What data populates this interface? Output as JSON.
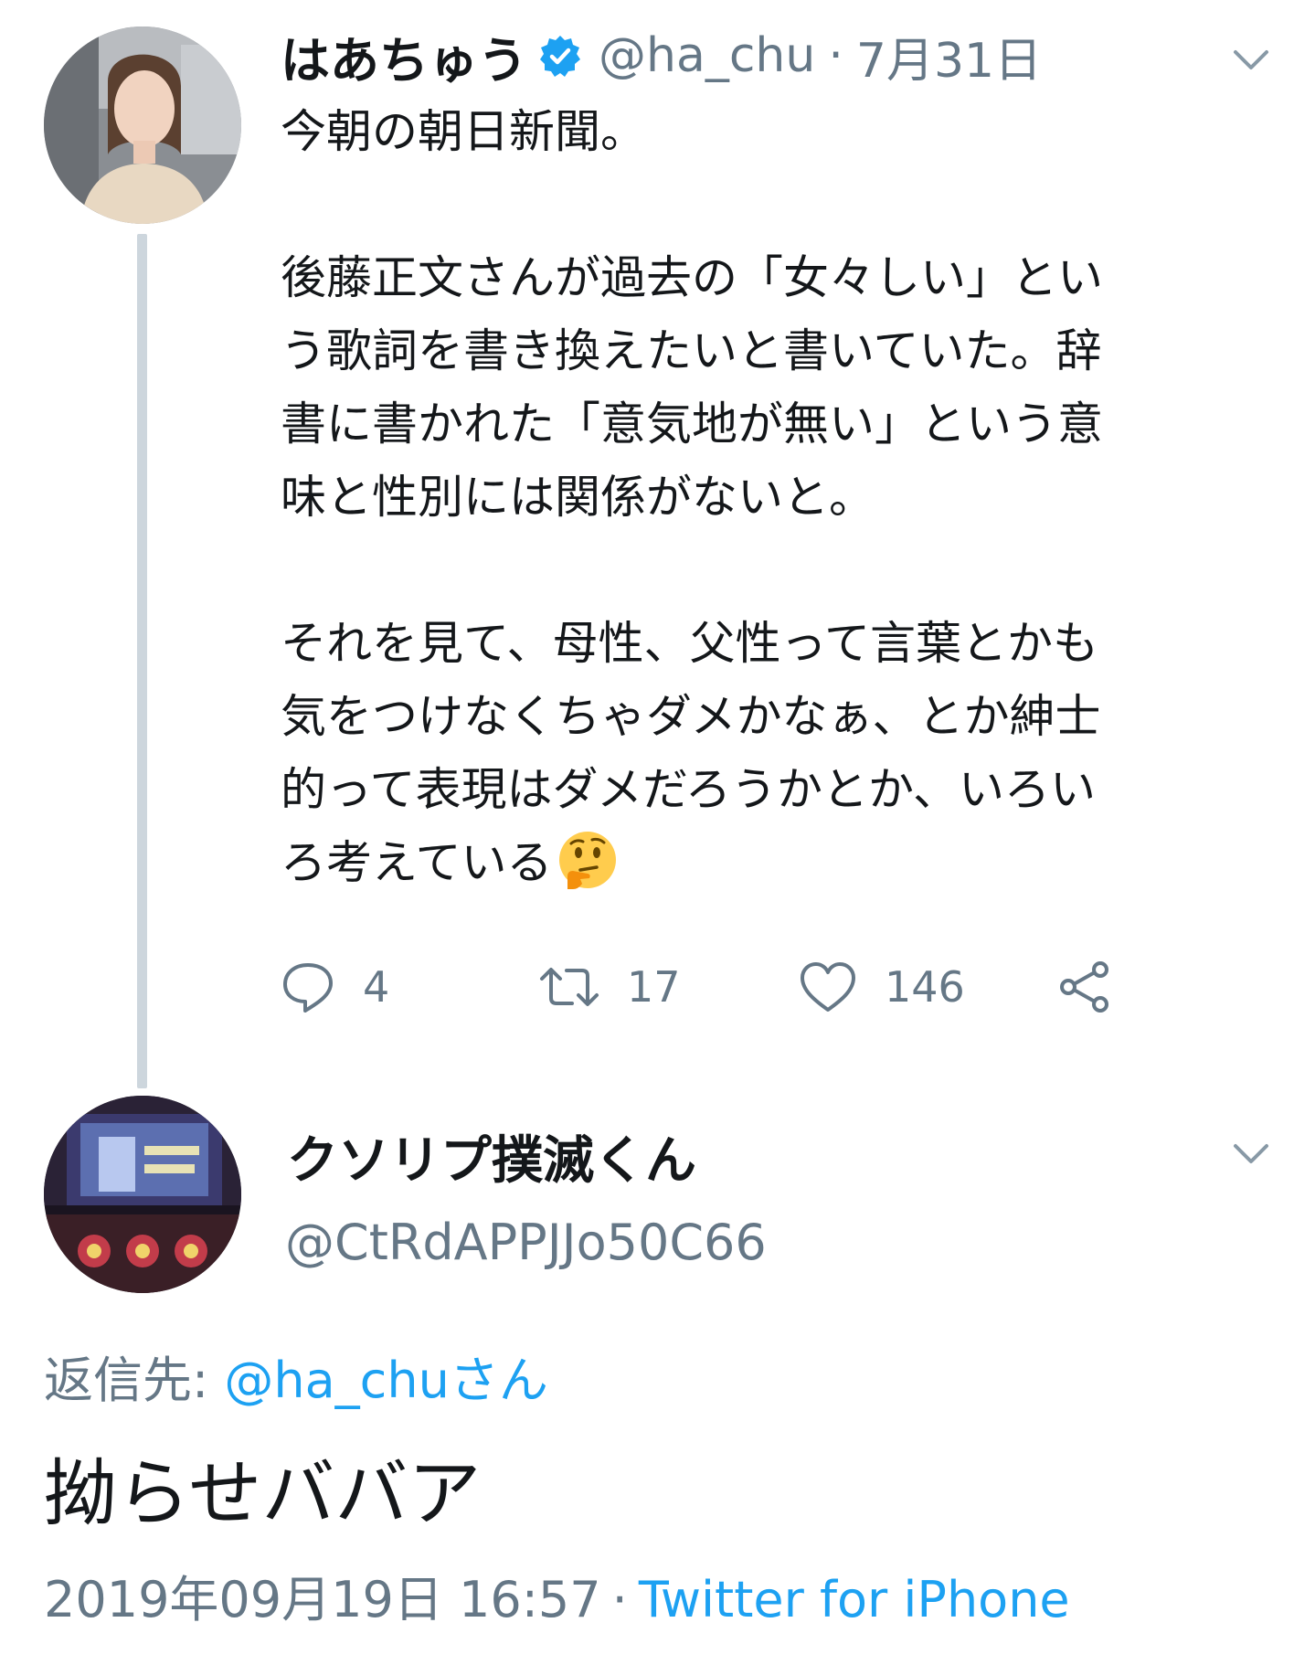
{
  "parent_tweet": {
    "display_name": "はあちゅう",
    "handle": "@ha_chu",
    "separator": "·",
    "date": "7月31日",
    "body_paragraphs": [
      [
        "今朝の朝日新聞。"
      ],
      [
        "後藤正文さんが過去の「女々しい」とい",
        "う歌詞を書き換えたいと書いていた。辞",
        "書に書かれた「意気地が無い」という意",
        "味と性別には関係がないと。"
      ],
      [
        "それを見て、母性、父性って言葉とかも",
        "気をつけなくちゃダメかなぁ、とか紳士",
        "的って表現はダメだろうかとか、いろい",
        "ろ考えている"
      ]
    ],
    "emoji": "thinking-face",
    "counts": {
      "replies": "4",
      "retweets": "17",
      "likes": "146"
    }
  },
  "reply_tweet": {
    "display_name": "クソリプ撲滅くん",
    "handle": "@CtRdAPPJJo50C66",
    "replying_to_label": "返信先: ",
    "replying_to_mention": "@ha_chuさん",
    "text": "拗らせババア",
    "timestamp": "2019年09月19日 16:57",
    "separator": "·",
    "source": "Twitter for iPhone"
  },
  "colors": {
    "text_primary": "#14171a",
    "text_secondary": "#657786",
    "link_blue": "#1da1f2",
    "thread_line": "#cdd6dd"
  }
}
